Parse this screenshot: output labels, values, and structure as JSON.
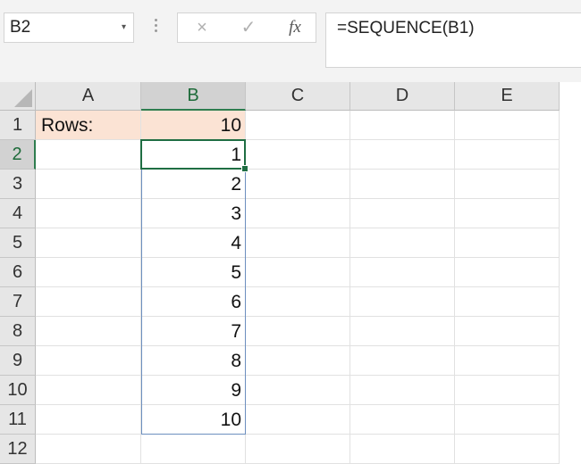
{
  "name_box": {
    "value": "B2",
    "arrow": "▾"
  },
  "formula_bar": {
    "cancel_icon": "×",
    "enter_icon": "✓",
    "fx_label": "fx",
    "formula": "=SEQUENCE(B1)"
  },
  "columns": [
    "A",
    "B",
    "C",
    "D",
    "E"
  ],
  "rows": [
    "1",
    "2",
    "3",
    "4",
    "5",
    "6",
    "7",
    "8",
    "9",
    "10",
    "11",
    "12"
  ],
  "selected": {
    "column": "B",
    "row": "2"
  },
  "cells": {
    "A1": "Rows:",
    "B1": "10",
    "B2": "1",
    "B3": "2",
    "B4": "3",
    "B5": "4",
    "B6": "5",
    "B7": "6",
    "B8": "7",
    "B9": "8",
    "B10": "9",
    "B11": "10"
  },
  "colors": {
    "header_fill": "#fbe3d4",
    "selection": "#1f6e43",
    "spill_border": "#6d8fbf"
  }
}
